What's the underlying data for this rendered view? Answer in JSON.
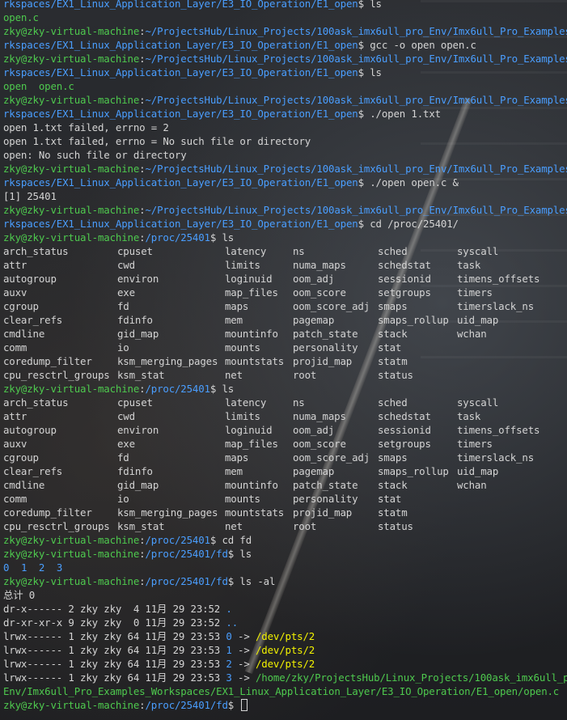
{
  "user": "zky@zky-virtual-machine",
  "lines_top": [
    {
      "path_tail": "rkspaces/EX1_Linux_Application_Layer/E3_IO_Operation/E1_open",
      "cmd": "ls"
    },
    {
      "text": "open.c"
    },
    {
      "path_head": "~/ProjectsHub/Linux_Projects/100ask_imx6ull_pro_Env/Imx6ull_Pro_Examples_Wo"
    },
    {
      "path_tail": "rkspaces/EX1_Linux_Application_Layer/E3_IO_Operation/E1_open",
      "cmd": "gcc -o open open.c"
    },
    {
      "path_head": "~/ProjectsHub/Linux_Projects/100ask_imx6ull_pro_Env/Imx6ull_Pro_Examples_Wo"
    },
    {
      "path_tail": "rkspaces/EX1_Linux_Application_Layer/E3_IO_Operation/E1_open",
      "cmd": "ls"
    },
    {
      "text": "open  open.c"
    },
    {
      "path_head": "~/ProjectsHub/Linux_Projects/100ask_imx6ull_pro_Env/Imx6ull_Pro_Examples_Wo"
    },
    {
      "path_tail": "rkspaces/EX1_Linux_Application_Layer/E3_IO_Operation/E1_open",
      "cmd": "./open 1.txt"
    },
    {
      "text": "open 1.txt failed, errno = 2"
    },
    {
      "text": "open 1.txt failed, errno = No such file or directory"
    },
    {
      "text": "open: No such file or directory"
    },
    {
      "path_head": "~/ProjectsHub/Linux_Projects/100ask_imx6ull_pro_Env/Imx6ull_Pro_Examples_Wo"
    },
    {
      "path_tail": "rkspaces/EX1_Linux_Application_Layer/E3_IO_Operation/E1_open",
      "cmd": "./open open.c &"
    },
    {
      "text": "[1] 25401"
    },
    {
      "path_head": "~/ProjectsHub/Linux_Projects/100ask_imx6ull_pro_Env/Imx6ull_Pro_Examples_Wo"
    },
    {
      "path_tail": "rkspaces/EX1_Linux_Application_Layer/E3_IO_Operation/E1_open",
      "cmd": "cd /proc/25401/"
    }
  ],
  "proc_path": "/proc/25401",
  "cmd_ls": "ls",
  "proc_listing": [
    [
      {
        "t": "arch_status"
      },
      {
        "t": "cpuset"
      },
      {
        "t": "latency"
      },
      {
        "t": "ns",
        "c": "b"
      },
      {
        "t": "sched"
      },
      {
        "t": "syscall"
      }
    ],
    [
      {
        "t": "attr",
        "c": "b"
      },
      {
        "t": "cwd",
        "c": "b"
      },
      {
        "t": "limits"
      },
      {
        "t": "numa_maps"
      },
      {
        "t": "schedstat"
      },
      {
        "t": "task",
        "c": "b"
      }
    ],
    [
      {
        "t": "autogroup"
      },
      {
        "t": "environ"
      },
      {
        "t": "loginuid"
      },
      {
        "t": "oom_adj"
      },
      {
        "t": "sessionid"
      },
      {
        "t": "timens_offsets"
      }
    ],
    [
      {
        "t": "auxv"
      },
      {
        "t": "exe",
        "c": "b"
      },
      {
        "t": "map_files",
        "c": "b"
      },
      {
        "t": "oom_score"
      },
      {
        "t": "setgroups"
      },
      {
        "t": "timers"
      }
    ],
    [
      {
        "t": "cgroup"
      },
      {
        "t": "fd",
        "c": "b"
      },
      {
        "t": "maps"
      },
      {
        "t": "oom_score_adj"
      },
      {
        "t": "smaps"
      },
      {
        "t": "timerslack_ns"
      }
    ],
    [
      {
        "t": "clear_refs"
      },
      {
        "t": "fdinfo",
        "c": "b"
      },
      {
        "t": "mem"
      },
      {
        "t": "pagemap"
      },
      {
        "t": "smaps_rollup"
      },
      {
        "t": "uid_map"
      }
    ],
    [
      {
        "t": "cmdline"
      },
      {
        "t": "gid_map"
      },
      {
        "t": "mountinfo"
      },
      {
        "t": "patch_state"
      },
      {
        "t": "stack"
      },
      {
        "t": "wchan"
      }
    ],
    [
      {
        "t": "comm"
      },
      {
        "t": "io"
      },
      {
        "t": "mounts"
      },
      {
        "t": "personality"
      },
      {
        "t": "stat"
      },
      {
        "t": ""
      }
    ],
    [
      {
        "t": "coredump_filter"
      },
      {
        "t": "ksm_merging_pages"
      },
      {
        "t": "mountstats"
      },
      {
        "t": "projid_map"
      },
      {
        "t": "statm"
      },
      {
        "t": ""
      }
    ],
    [
      {
        "t": "cpu_resctrl_groups"
      },
      {
        "t": "ksm_stat"
      },
      {
        "t": "net",
        "c": "b"
      },
      {
        "t": "root",
        "c": "b"
      },
      {
        "t": "status"
      },
      {
        "t": ""
      }
    ]
  ],
  "cmd_cd_fd": "cd fd",
  "fd_path": "/proc/25401/fd",
  "fd_listing": [
    "0",
    "1",
    "2",
    "3"
  ],
  "cmd_ls_al": "ls -al",
  "total_line": "总计 0",
  "ls_al": [
    {
      "perm": "dr-x------ 2 zky zky  4 11月 29 23:52 ",
      "name": ".",
      "c": "b"
    },
    {
      "perm": "dr-xr-xr-x 9 zky zky  0 11月 29 23:52 ",
      "name": "..",
      "c": "b"
    },
    {
      "perm": "lrwx------ 1 zky zky 64 11月 29 23:53 ",
      "fd": "0",
      "arrow": " -> ",
      "target": "/dev/pts/2",
      "c": "y"
    },
    {
      "perm": "lrwx------ 1 zky zky 64 11月 29 23:53 ",
      "fd": "1",
      "arrow": " -> ",
      "target": "/dev/pts/2",
      "c": "y"
    },
    {
      "perm": "lrwx------ 1 zky zky 64 11月 29 23:53 ",
      "fd": "2",
      "arrow": " -> ",
      "target": "/dev/pts/2",
      "c": "y"
    },
    {
      "perm": "lrwx------ 1 zky zky 64 11月 29 23:53 ",
      "fd": "3",
      "arrow": " -> ",
      "target": "/home/zky/ProjectsHub/Linux_Projects/100ask_imx6ull_pro_",
      "c": "g"
    }
  ],
  "ls_al_wrap": "Env/Imx6ull_Pro_Examples_Workspaces/EX1_Linux_Application_Layer/E3_IO_Operation/E1_open/open.c",
  "colors": {
    "prompt_user": "#4ec94e",
    "prompt_path": "#4a9eff",
    "symlink_target": "#f2f200",
    "fg": "#d4d4d4"
  }
}
